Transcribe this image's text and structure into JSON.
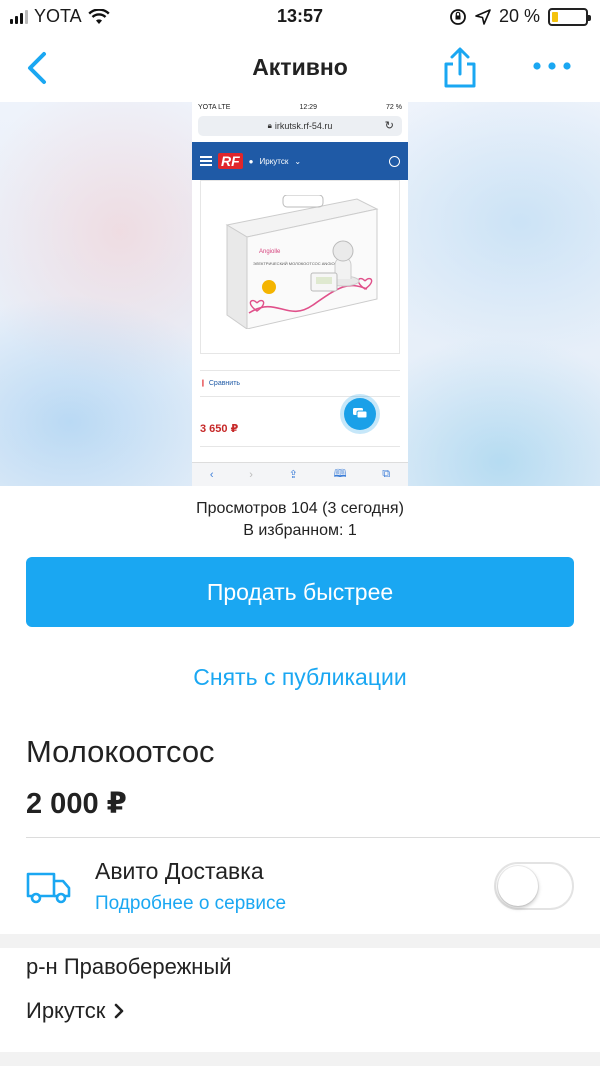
{
  "status_bar": {
    "carrier": "YOTA",
    "time": "13:57",
    "battery_percent": "20 %",
    "battery_level": 0.2,
    "icons": [
      "signal-icon",
      "wifi-icon",
      "orientation-lock-icon",
      "location-arrow-icon",
      "battery-icon"
    ]
  },
  "nav": {
    "title": "Активно",
    "back_icon": "chevron-left-icon",
    "share_icon": "share-icon",
    "more_icon": "more-dots-icon"
  },
  "photo": {
    "status_carrier": "YOTA  LTE",
    "status_time": "12:29",
    "status_battery": "72 %",
    "url": "irkutsk.rf-54.ru",
    "site_logo": "RF",
    "site_city": "Иркутск",
    "box_brand": "Angiolle",
    "box_text": "ЭЛЕКТРИЧЕСКИЙ МОЛОКООТСОС ANGIOLLE",
    "compare_label": "Сравнить",
    "price": "3 650 ₽"
  },
  "stats": {
    "views": "Просмотров 104 (3 сегодня)",
    "favorites": "В избранном: 1"
  },
  "actions": {
    "sell_faster": "Продать быстрее",
    "unpublish": "Снять с публикации"
  },
  "item": {
    "title": "Молокоотсос",
    "price": "2 000 ₽"
  },
  "delivery": {
    "title": "Авито Доставка",
    "link": "Подробнее о сервисе",
    "enabled": false,
    "icon": "truck-icon"
  },
  "location": {
    "district": "р-н Правобережный",
    "city": "Иркутск"
  },
  "colors": {
    "accent": "#1aa7f2",
    "text": "#222222"
  }
}
